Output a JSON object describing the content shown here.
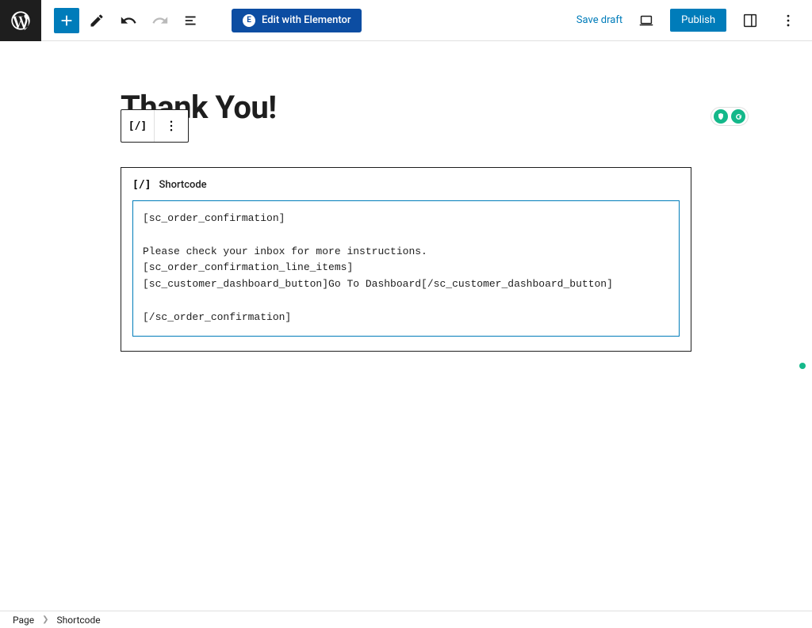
{
  "toolbar": {
    "elementor_label": "Edit with Elementor",
    "save_draft_label": "Save draft",
    "publish_label": "Publish"
  },
  "page": {
    "title": "Thank You!"
  },
  "block": {
    "type_label": "Shortcode",
    "content": "[sc_order_confirmation]\n\nPlease check your inbox for more instructions.\n[sc_order_confirmation_line_items]\n[sc_customer_dashboard_button]Go To Dashboard[/sc_customer_dashboard_button]\n\n[/sc_order_confirmation]"
  },
  "breadcrumb": {
    "root": "Page",
    "current": "Shortcode"
  }
}
